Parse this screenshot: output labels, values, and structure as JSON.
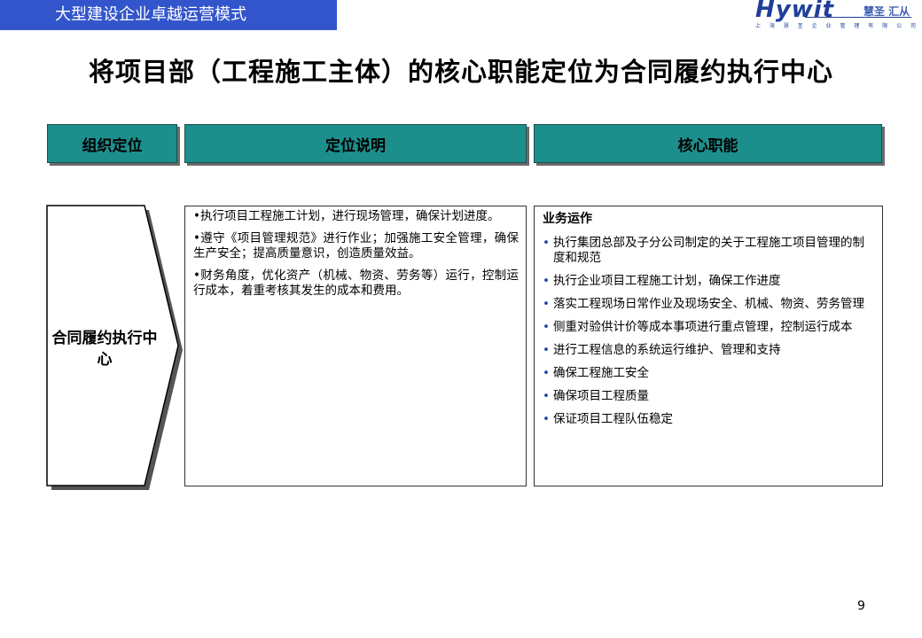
{
  "header": {
    "banner_title": "大型建设企业卓越运营模式",
    "logo_text": "Hywit",
    "logo_cn": "慧圣 汇从",
    "logo_sub": "上 海 慧 圣 企 业 管 理 有 限 公 司"
  },
  "title": "将项目部（工程施工主体）的核心职能定位为合同履约执行中心",
  "columns": {
    "col1": "组织定位",
    "col2": "定位说明",
    "col3": "核心职能"
  },
  "org_position": "合同履约执行中心",
  "descriptions": [
    "•执行项目工程施工计划，进行现场管理，确保计划进度。",
    "•遵守《项目管理规范》进行作业；加强施工安全管理，确保生产安全；提高质量意识，创造质量效益。",
    "•财务角度，优化资产（机械、物资、劳务等）运行，控制运行成本，着重考核其发生的成本和费用。"
  ],
  "functions": {
    "title": "业务运作",
    "bullet": "•",
    "items": [
      "执行集团总部及子分公司制定的关于工程施工项目管理的制度和规范",
      "执行企业项目工程施工计划，确保工作进度",
      "落实工程现场日常作业及现场安全、机械、物资、劳务管理",
      "侧重对验供计价等成本事项进行重点管理，控制运行成本",
      "进行工程信息的系统运行维护、管理和支持",
      "确保工程施工安全",
      "确保项目工程质量",
      "保证项目工程队伍稳定"
    ]
  },
  "page_number": "9",
  "colors": {
    "banner": "#3355cc",
    "header_fill": "#1c8f8c",
    "bullet": "#2244aa"
  }
}
